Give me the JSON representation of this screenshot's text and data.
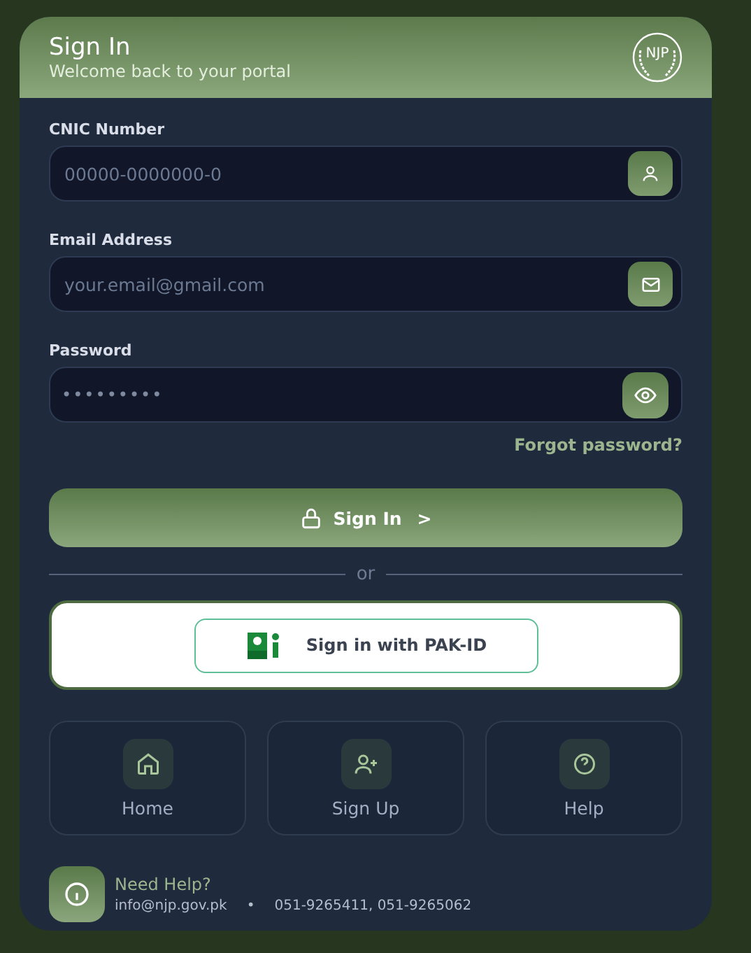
{
  "header": {
    "title": "Sign In",
    "subtitle": "Welcome back to your portal",
    "logo_text": "NJP"
  },
  "fields": [
    {
      "label": "CNIC Number",
      "placeholder": "00000-0000000-0",
      "kind": "user"
    },
    {
      "label": "Email Address",
      "placeholder": "your.email@gmail.com",
      "kind": "mail"
    },
    {
      "label": "Password",
      "value": "•••••••••",
      "kind": "password"
    }
  ],
  "forgot_link": "Forgot password?",
  "sign_in_button": {
    "label": "Sign In",
    "arrow": ">"
  },
  "divider": "or",
  "pak_id_button": "Sign in with PAK-ID",
  "nav": [
    {
      "label": "Home",
      "kind": "home"
    },
    {
      "label": "Sign Up",
      "kind": "signup"
    },
    {
      "label": "Help",
      "kind": "help"
    }
  ],
  "help": {
    "title": "Need Help?",
    "email": "info@njp.gov.pk",
    "separator": "•",
    "phones": "051-9265411, 051-9265062"
  }
}
